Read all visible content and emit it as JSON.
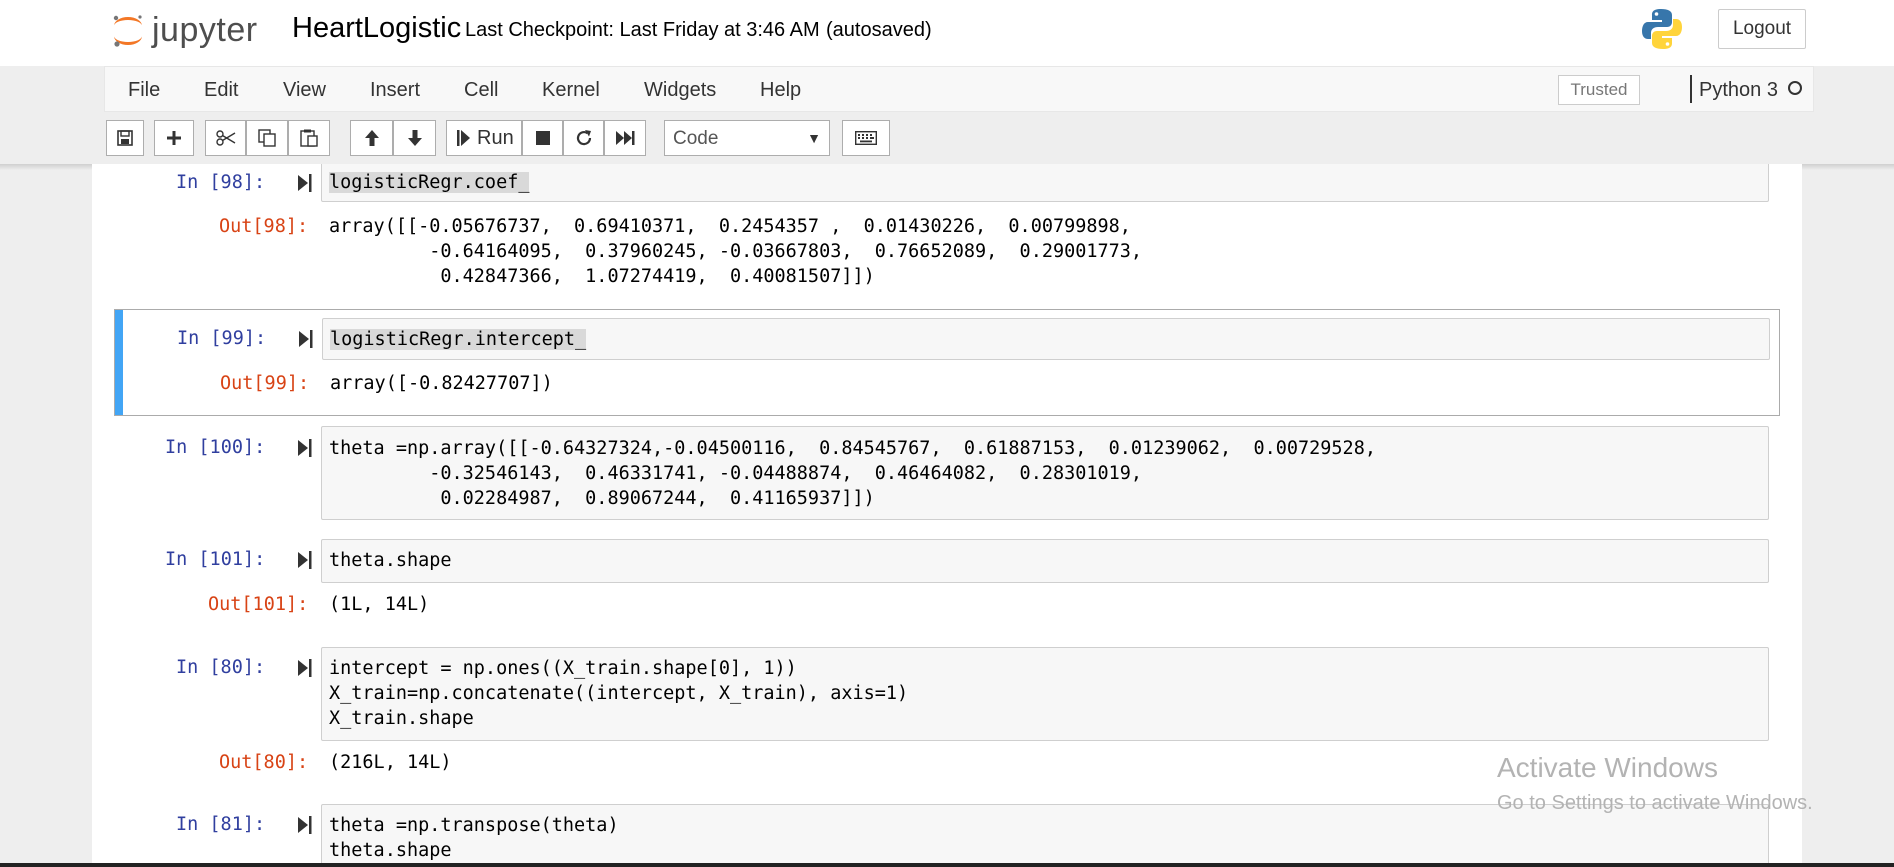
{
  "header": {
    "logo_text": "jupyter",
    "notebook_name": "HeartLogistic",
    "checkpoint": "Last Checkpoint: Last Friday at 3:46 AM",
    "autosave": "(autosaved)",
    "logout_label": "Logout"
  },
  "menu": {
    "items": [
      "File",
      "Edit",
      "View",
      "Insert",
      "Cell",
      "Kernel",
      "Widgets",
      "Help"
    ],
    "trusted": "Trusted",
    "kernel": "Python 3"
  },
  "toolbar": {
    "run_label": "Run",
    "cell_type": "Code",
    "buttons": [
      "save-icon",
      "plus-icon",
      "scissors-icon",
      "copy-icon",
      "paste-icon",
      "arrow-up-icon",
      "arrow-down-icon",
      "run-icon",
      "stop-icon",
      "restart-icon",
      "fast-forward-icon",
      "keyboard-icon"
    ]
  },
  "cells": [
    {
      "in": "In [98]:",
      "code": [
        "logisticRegr.coef_"
      ],
      "out": "Out[98]:",
      "output": [
        "array([[-0.05676737,  0.69410371,  0.2454357 ,  0.01430226,  0.00799898,",
        "         -0.64164095,  0.37960245, -0.03667803,  0.76652089,  0.29001773,",
        "          0.42847366,  1.07274419,  0.40081507]])"
      ]
    },
    {
      "in": "In [99]:",
      "code": [
        "logisticRegr.intercept_"
      ],
      "out": "Out[99]:",
      "output": [
        "array([-0.82427707])"
      ]
    },
    {
      "in": "In [100]:",
      "code": [
        "theta =np.array([[-0.64327324,-0.04500116,  0.84545767,  0.61887153,  0.01239062,  0.00729528,",
        "         -0.32546143,  0.46331741, -0.04488874,  0.46464082,  0.28301019,",
        "          0.02284987,  0.89067244,  0.41165937]])"
      ]
    },
    {
      "in": "In [101]:",
      "code": [
        "theta.shape"
      ],
      "out": "Out[101]:",
      "output": [
        "(1L, 14L)"
      ]
    },
    {
      "in": "In [80]:",
      "code": [
        "intercept = np.ones((X_train.shape[0], 1))",
        "X_train=np.concatenate((intercept, X_train), axis=1)",
        "X_train.shape"
      ],
      "out": "Out[80]:",
      "output": [
        "(216L, 14L)"
      ]
    },
    {
      "in": "In [81]:",
      "code": [
        "theta =np.transpose(theta)",
        "theta.shape"
      ]
    }
  ],
  "watermark": {
    "title": "Activate Windows",
    "subtitle": "Go to Settings to activate Windows."
  },
  "colors": {
    "prompt_in": "#303f9f",
    "prompt_out": "#d84315",
    "selected_bar": "#42a5f5",
    "number": "#008800",
    "operator": "#aa22ff"
  }
}
